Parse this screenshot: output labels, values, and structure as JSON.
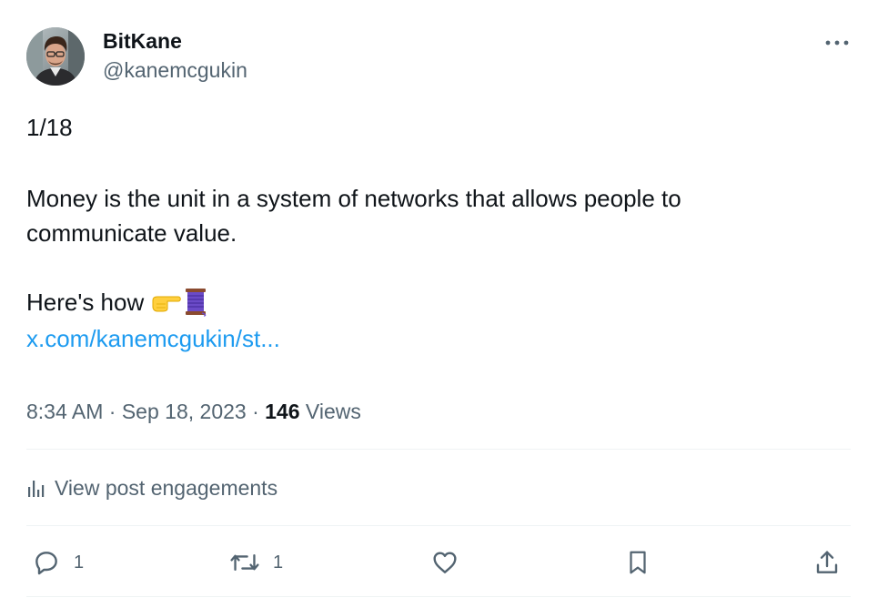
{
  "author": {
    "display_name": "BitKane",
    "handle": "@kanemcgukin"
  },
  "post": {
    "thread_count": "1/18",
    "text_line_1": "Money is the unit in a system of networks that allows people to",
    "text_line_2": "communicate value.",
    "text_line_3": "Here's how",
    "emojis": [
      "backhand-index-pointing-right",
      "spool-of-thread"
    ],
    "link": "x.com/kanemcgukin/st..."
  },
  "meta": {
    "time": "8:34 AM",
    "separator": "·",
    "date": "Sep 18, 2023",
    "views_count": "146",
    "views_label": "Views"
  },
  "engagements": {
    "label": "View post engagements",
    "icon": "analytics-icon"
  },
  "actions": {
    "reply_count": "1",
    "repost_count": "1"
  },
  "colors": {
    "text_primary": "#0f1419",
    "text_secondary": "#536471",
    "link": "#1d9bf0",
    "divider": "#eff3f4"
  }
}
